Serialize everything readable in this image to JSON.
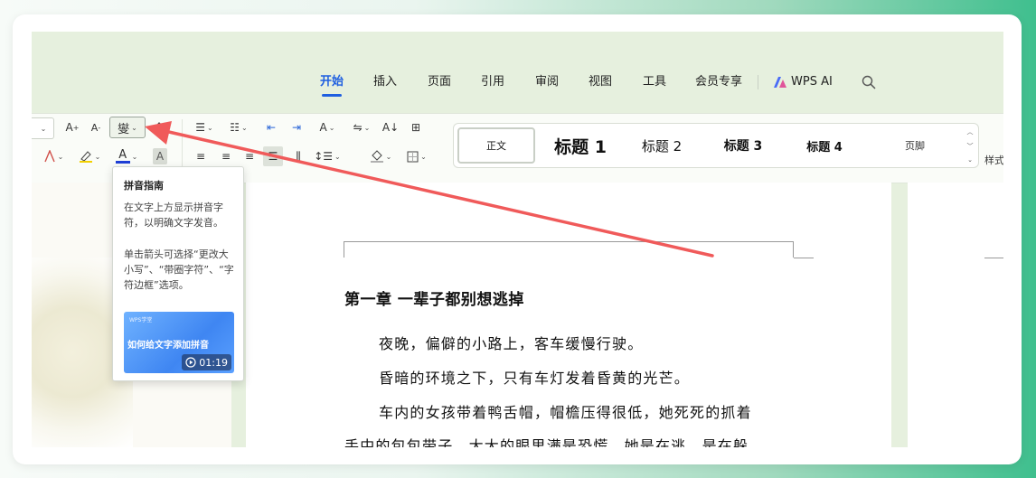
{
  "tabs": [
    {
      "label": "开始",
      "active": true
    },
    {
      "label": "插入"
    },
    {
      "label": "页面"
    },
    {
      "label": "引用"
    },
    {
      "label": "审阅"
    },
    {
      "label": "视图"
    },
    {
      "label": "工具"
    },
    {
      "label": "会员专享"
    }
  ],
  "wps_ai_label": "WPS AI",
  "ribbon": {
    "grow_font": "A",
    "shrink_font": "A",
    "pinyin_glyph": "燮",
    "styles": {
      "normal": "正文",
      "h1": "标题 1",
      "h2": "标题 2",
      "h3": "标题 3",
      "h4": "标题 4",
      "footer": "页脚",
      "styles_set": "样式"
    }
  },
  "tooltip": {
    "title": "拼音指南",
    "desc1": "在文字上方显示拼音字符，以明确文字发音。",
    "desc2": "单击箭头可选择“更改大小写”、“带圈字符”、“字符边框”选项。",
    "video_brand": "WPS学堂",
    "video_caption": "如何给文字添加拼音",
    "video_duration": "01:19"
  },
  "document": {
    "chapter_title": "第一章  一辈子都别想逃掉",
    "lines": [
      "夜晚，偏僻的小路上，客车缓慢行驶。",
      "昏暗的环境之下，只有车灯发着昏黄的光芒。",
      "车内的女孩带着鸭舌帽，帽檐压得很低，她死死的抓着",
      "手中的包包带子，大大的眼里满是恐慌。她是在逃，是在躲"
    ]
  },
  "colors": {
    "accent": "#1f5fe0",
    "annotation_arrow": "#f05a5a",
    "font_color_bar": "#1f3fd6"
  }
}
